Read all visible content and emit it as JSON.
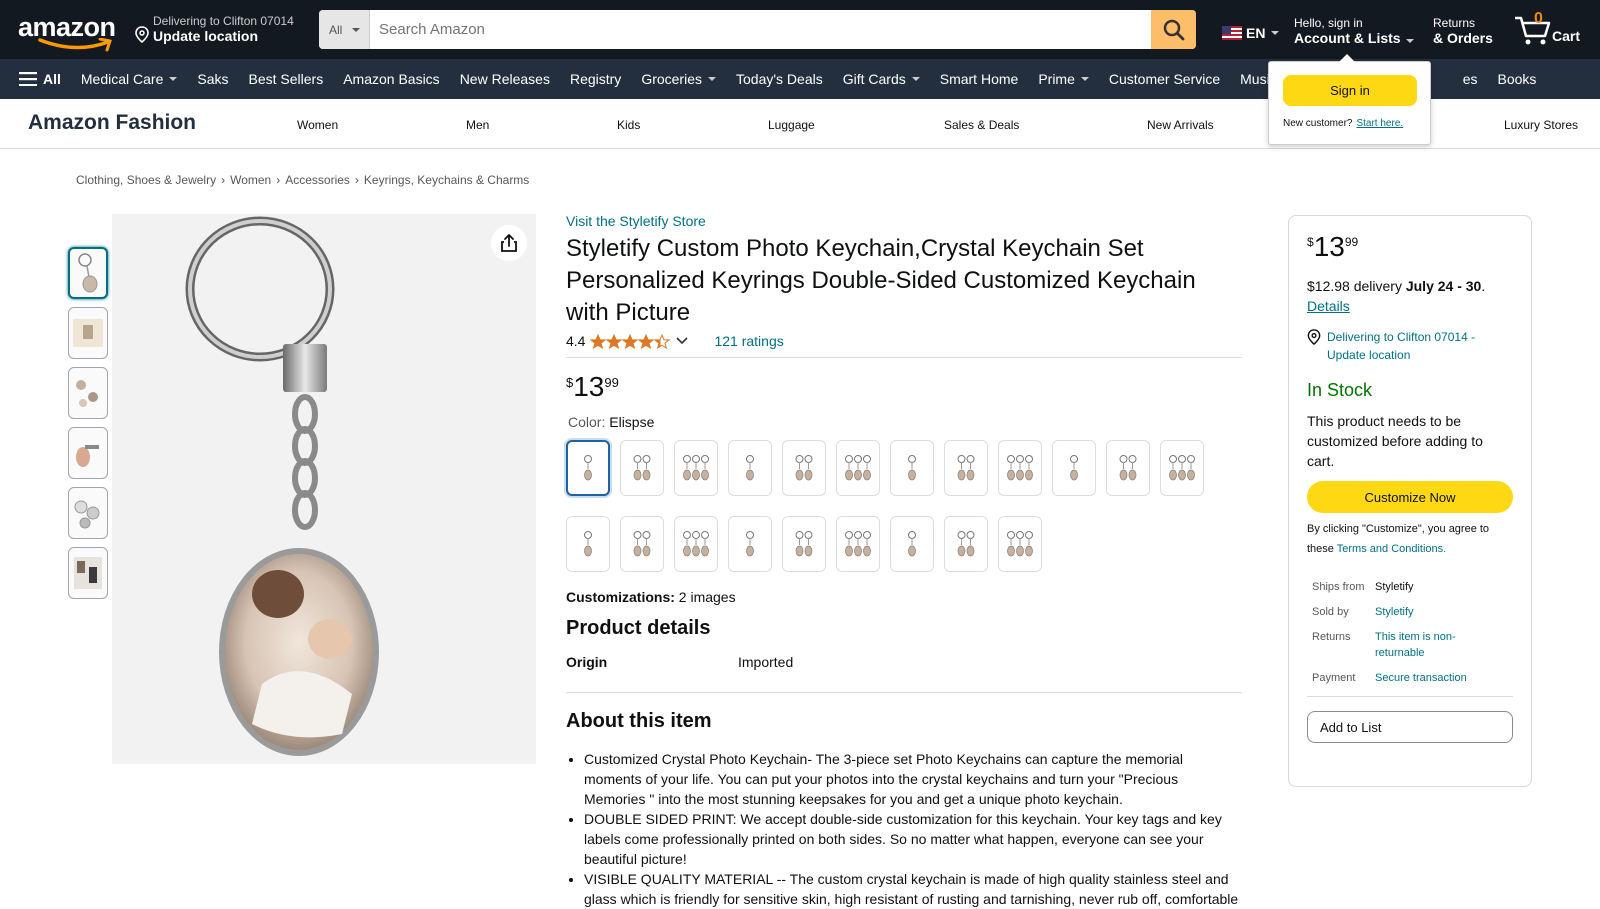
{
  "header": {
    "logo": "amazon",
    "deliver_line1": "Delivering to Clifton 07014",
    "deliver_line2": "Update location",
    "search_category": "All",
    "search_placeholder": "Search Amazon",
    "language": "EN",
    "account_line1": "Hello, sign in",
    "account_line2": "Account & Lists",
    "orders_line1": "Returns",
    "orders_line2": "& Orders",
    "cart_count": "0",
    "cart_label": "Cart"
  },
  "nav": {
    "all": "All",
    "items": [
      "Medical Care",
      "Saks",
      "Best Sellers",
      "Amazon Basics",
      "New Releases",
      "Registry",
      "Groceries",
      "Today's Deals",
      "Gift Cards",
      "Smart Home",
      "Prime",
      "Customer Service",
      "Music",
      "Books"
    ],
    "partial_item": "es"
  },
  "popover": {
    "signin": "Sign in",
    "new_customer": "New customer?",
    "start_here": "Start here."
  },
  "fashion": {
    "brand": "Amazon Fashion",
    "links": [
      "Women",
      "Men",
      "Kids",
      "Luggage",
      "Sales & Deals",
      "New Arrivals",
      "Luxury Stores"
    ]
  },
  "breadcrumb": [
    "Clothing, Shoes & Jewelry",
    "Women",
    "Accessories",
    "Keyrings, Keychains & Charms"
  ],
  "product": {
    "store": "Visit the Styletify Store",
    "title": "Styletify Custom Photo Keychain,Crystal Keychain Set Personalized Keyrings Double-Sided Customized Keychain with Picture",
    "rating": "4.4",
    "rating_value": 4.4,
    "ratings_count": "121 ratings",
    "price_symbol": "$",
    "price_whole": "13",
    "price_fraction": "99",
    "color_label": "Color:",
    "color_value": "Elispse",
    "swatch_count_row1": 12,
    "swatch_count_row2": 9,
    "customizations_label": "Customizations:",
    "customizations_value": "2 images",
    "details_heading": "Product details",
    "origin_label": "Origin",
    "origin_value": "Imported",
    "about_heading": "About this item",
    "bullets": [
      "Customized Crystal Photo Keychain- The 3-piece set Photo Keychains can capture the memorial moments of your life. You can put your photos into the crystal keychains and turn your \"Precious Memories \" into the most stunning keepsakes for you and get a unique photo keychain.",
      "DOUBLE SIDED PRINT: We accept double-side customization for this keychain. Your key tags and key labels come professionally printed on both sides. So no matter what happen, everyone can see your beautiful picture!",
      "VISIBLE QUALITY MATERIAL -- The custom crystal keychain is made of high quality stainless steel and glass which is friendly for sensitive skin, high resistant of rusting and tarnishing, never rub off, comfortable"
    ]
  },
  "buybox": {
    "price_symbol": "$",
    "price_whole": "13",
    "price_fraction": "99",
    "delivery_prefix": "$12.98 delivery ",
    "delivery_dates": "July 24 - 30",
    "delivery_suffix": ".",
    "details_link": "Details",
    "location": "Delivering to Clifton 07014 - Update location",
    "stock": "In Stock",
    "needs_custom": "This product needs to be customized before adding to cart.",
    "customize_button": "Customize Now",
    "terms_prefix": "By clicking \"Customize\", you agree to these ",
    "terms_link": "Terms and Conditions.",
    "ships_from_label": "Ships from",
    "ships_from_value": "Styletify",
    "sold_by_label": "Sold by",
    "sold_by_value": "Styletify",
    "returns_label": "Returns",
    "returns_value": "This item is non-returnable",
    "payment_label": "Payment",
    "payment_value": "Secure transaction",
    "add_to_list": "Add to List"
  },
  "colors": {
    "topbar": "#131921",
    "navbar": "#232f3e",
    "accent_orange": "#febd69",
    "button_yellow": "#ffd814",
    "link": "#007185",
    "in_stock": "#007600",
    "star": "#de7921"
  }
}
